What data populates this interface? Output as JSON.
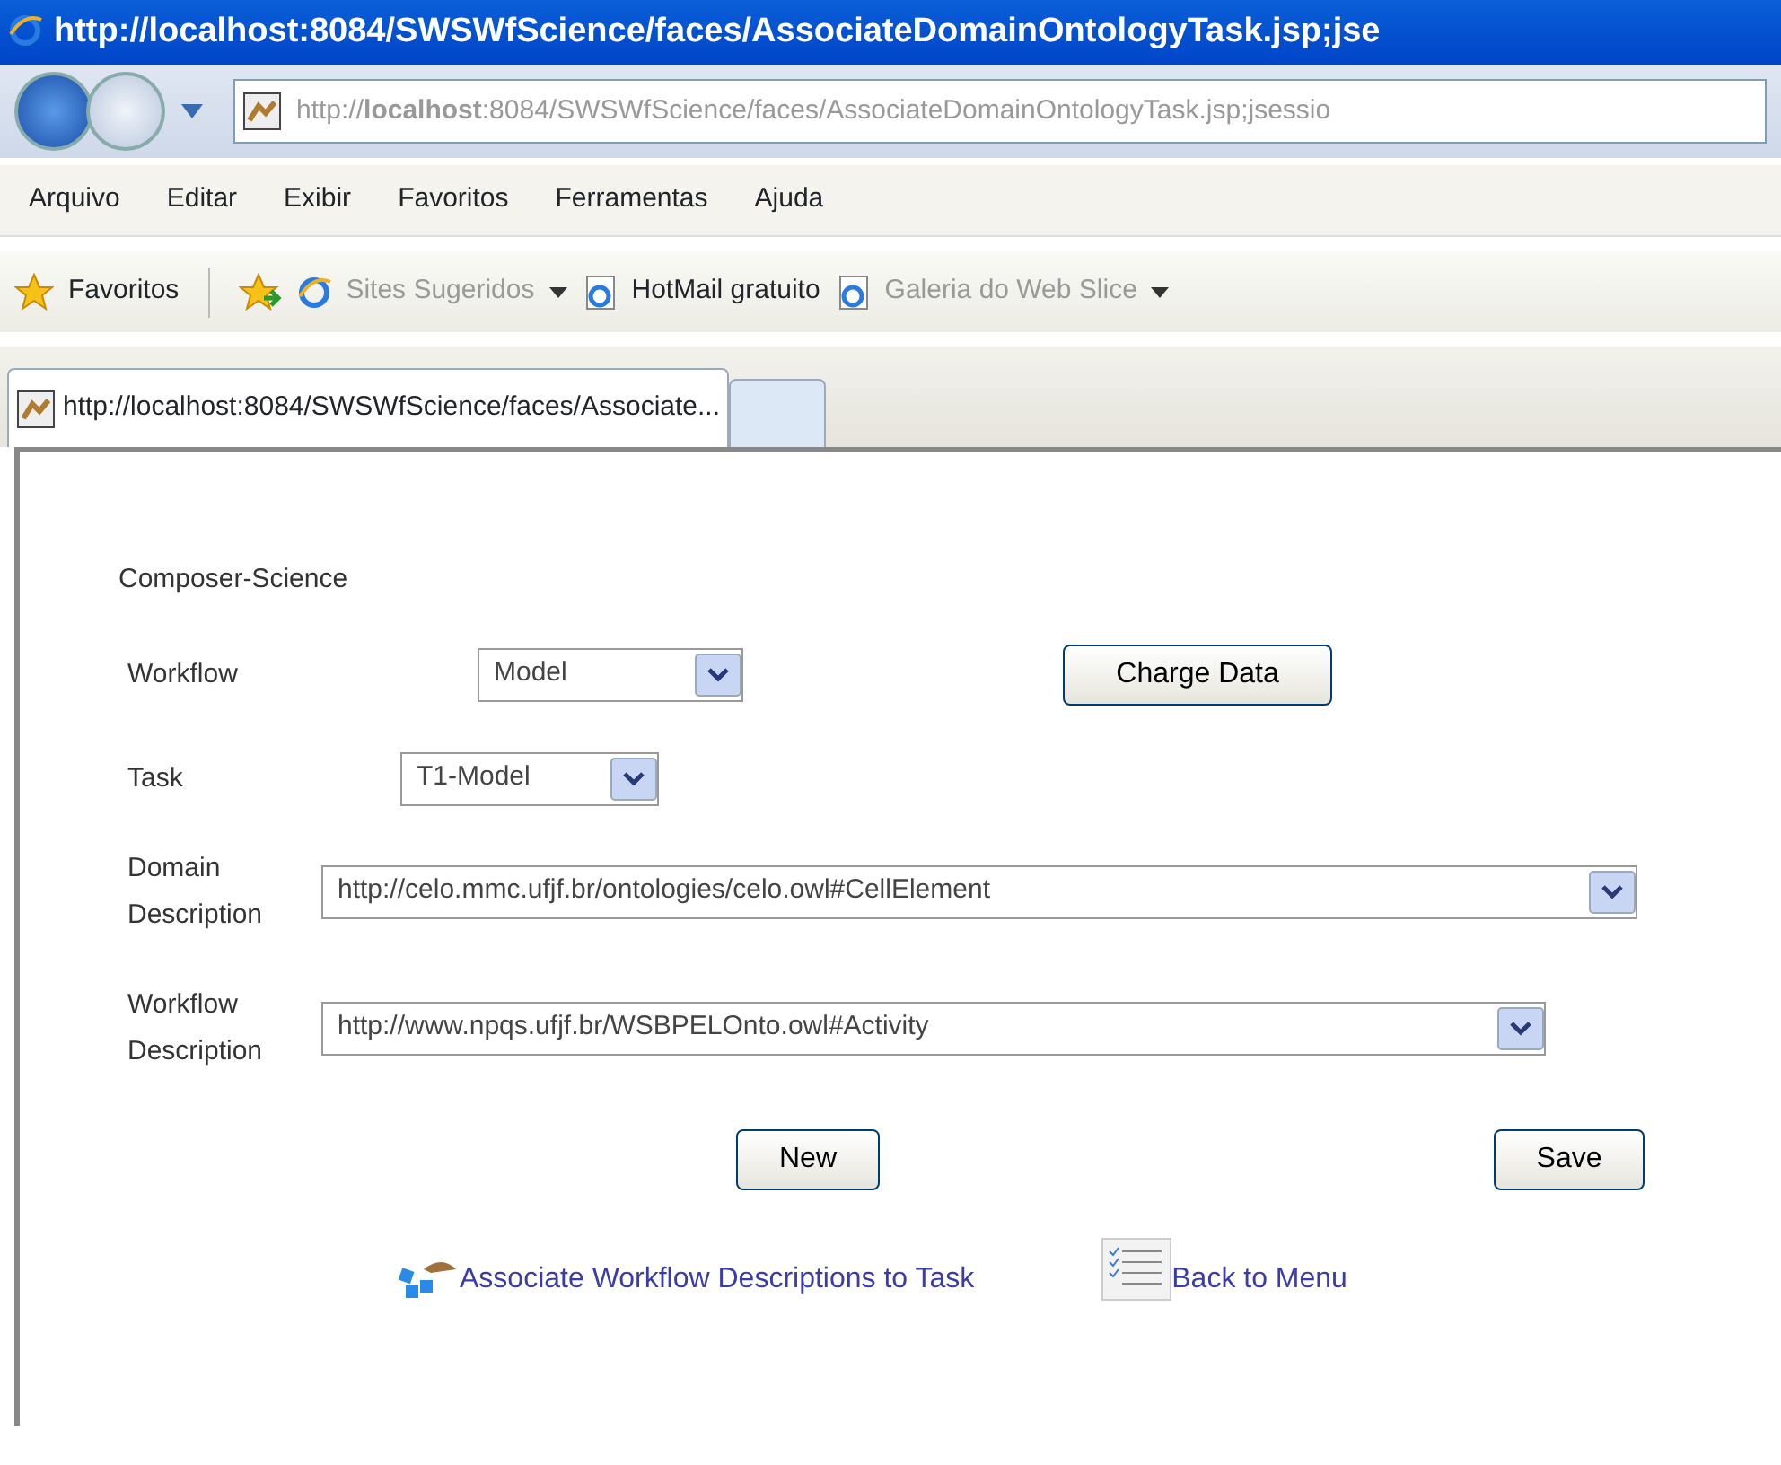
{
  "window": {
    "title": "http://localhost:8084/SWSWfScience/faces/AssociateDomainOntologyTask.jsp;jse"
  },
  "address": "http://**localhost**:8084/SWSWfScience/faces/AssociateDomainOntologyTask.jsp;jsessio",
  "menu": [
    "Arquivo",
    "Editar",
    "Exibir",
    "Favoritos",
    "Ferramentas",
    "Ajuda"
  ],
  "favorites_bar": {
    "label": "Favoritos",
    "items": [
      {
        "label": "Sites Sugeridos",
        "disabled": true,
        "dropdown": true
      },
      {
        "label": "HotMail gratuito",
        "disabled": false,
        "dropdown": false
      },
      {
        "label": "Galeria do Web Slice",
        "disabled": true,
        "dropdown": true
      }
    ]
  },
  "tabs": [
    {
      "label": "http://localhost:8084/SWSWfScience/faces/Associate...",
      "selected": true
    }
  ],
  "page": {
    "heading": "Composer-Science",
    "workflow": {
      "label": "Workflow",
      "value": "Model"
    },
    "charge_button": "Charge Data",
    "task": {
      "label": "Task",
      "value": "T1-Model"
    },
    "domain": {
      "label": "Domain Description",
      "value": "http://celo.mmc.ufjf.br/ontologies/celo.owl#CellElement"
    },
    "workflow_description": {
      "label": "Workflow Description",
      "value": "http://www.npqs.ufjf.br/WSBPELOnto.owl#Activity"
    },
    "buttons": [
      "New",
      "Save"
    ],
    "links": [
      "Associate Workflow Descriptions to Task",
      "Back to Menu"
    ]
  }
}
